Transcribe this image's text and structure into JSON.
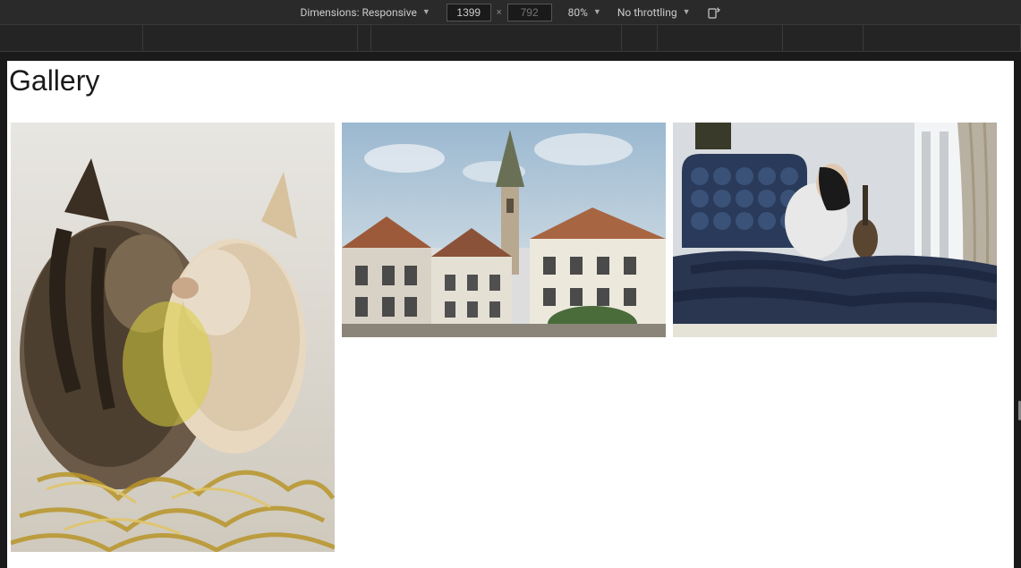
{
  "toolbar": {
    "dimensions_label": "Dimensions: Responsive",
    "width_value": "1399",
    "height_placeholder": "792",
    "zoom_label": "80%",
    "throttling_label": "No throttling",
    "separator": "×"
  },
  "page": {
    "title": "Gallery"
  },
  "gallery": {
    "items": [
      {
        "name": "cats",
        "alt": "Two cats nuzzling"
      },
      {
        "name": "town",
        "alt": "European town with church spire"
      },
      {
        "name": "bedroom",
        "alt": "Person sitting on bed looking at window"
      }
    ]
  }
}
